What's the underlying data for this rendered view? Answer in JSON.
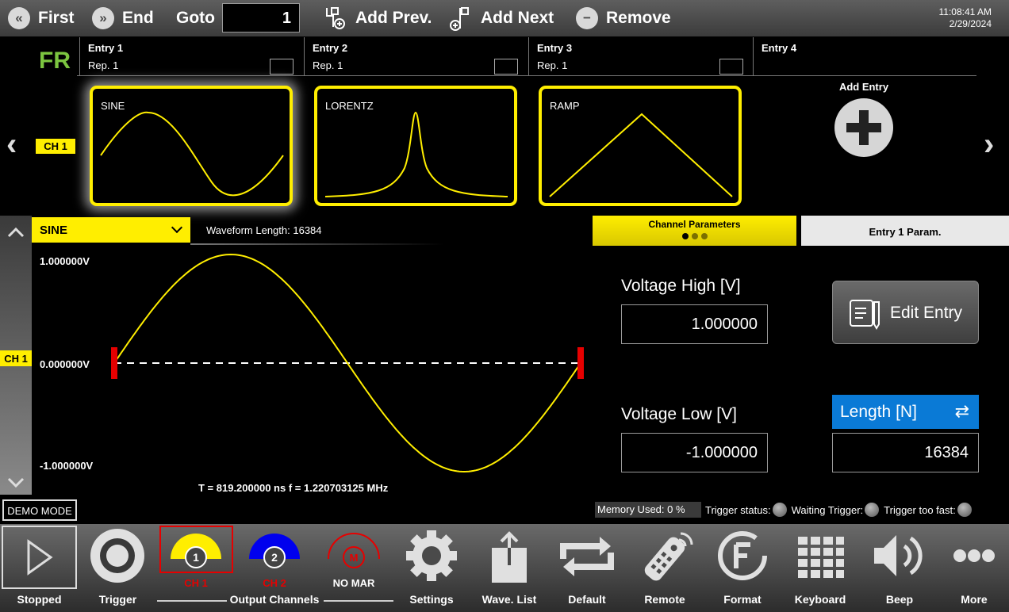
{
  "topbar": {
    "first": "First",
    "end": "End",
    "goto_label": "Goto",
    "goto_value": "1",
    "add_prev": "Add Prev.",
    "add_next": "Add Next",
    "remove": "Remove",
    "time": "11:08:41 AM",
    "date": "2/29/2024"
  },
  "sequencer": {
    "mode": "FR",
    "channel": "CH 1",
    "entries": [
      {
        "title": "Entry  1",
        "rep": "Rep.  1",
        "waveform": "SINE"
      },
      {
        "title": "Entry  2",
        "rep": "Rep.  1",
        "waveform": "LORENTZ"
      },
      {
        "title": "Entry  3",
        "rep": "Rep.  1",
        "waveform": "RAMP"
      },
      {
        "title": "Entry  4"
      }
    ],
    "add_entry": "Add Entry"
  },
  "waveform": {
    "selected": "SINE",
    "length_label": "Waveform Length:",
    "length_value": "16384",
    "y_max": "1.000000V",
    "y_mid": "0.000000V",
    "y_min": "-1.000000V",
    "channel": "CH 1",
    "period": "T =  819.200000 ns   f =  1.220703125 MHz"
  },
  "tabs": {
    "channel_params": "Channel Parameters",
    "entry_params": "Entry  1  Param."
  },
  "params": {
    "vhigh_label": "Voltage High [V]",
    "vhigh_value": "1.000000",
    "vlow_label": "Voltage Low [V]",
    "vlow_value": "-1.000000",
    "edit_entry": "Edit Entry",
    "length_label": "Length [N]",
    "length_value": "16384"
  },
  "status": {
    "demo": "DEMO MODE",
    "memory": "Memory Used:   0 %",
    "trigger_status": "Trigger status:",
    "waiting": "Waiting Trigger:",
    "too_fast": "Trigger too fast:"
  },
  "toolbar": {
    "stopped": "Stopped",
    "trigger": "Trigger",
    "ch1": "CH 1",
    "ch2": "CH 2",
    "nomar": "NO MAR",
    "ch1_num": "1",
    "ch2_num": "2",
    "mar_letter": "M",
    "output_channels": "Output Channels",
    "settings": "Settings",
    "wave_list": "Wave. List",
    "default": "Default",
    "remote": "Remote",
    "format": "Format",
    "keyboard": "Keyboard",
    "beep": "Beep",
    "more": "More"
  },
  "colors": {
    "accent": "#ffee00",
    "blue": "#0a7ad6",
    "green": "#7cc540",
    "red": "#e60000"
  }
}
